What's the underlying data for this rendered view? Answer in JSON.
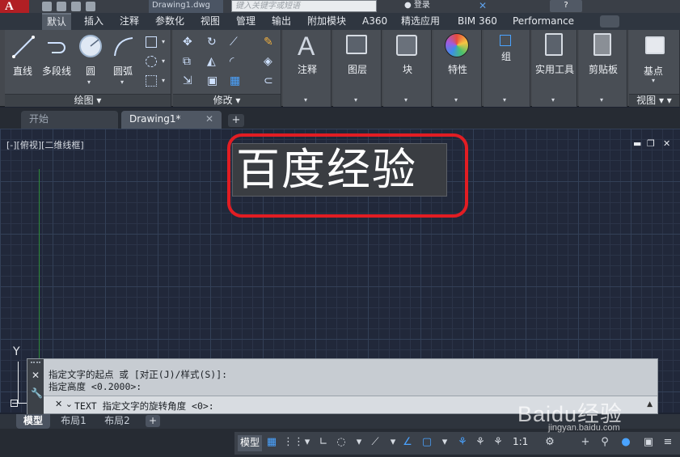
{
  "titlebar": {
    "app_logo": "A",
    "doc_name": "Drawing1.dwg",
    "search_placeholder": "键入关键字或短语",
    "login_label": "登录",
    "help_label": "?"
  },
  "ribbon_tabs": [
    "默认",
    "插入",
    "注释",
    "参数化",
    "视图",
    "管理",
    "输出",
    "附加模块",
    "A360",
    "精选应用",
    "BIM 360",
    "Performance"
  ],
  "draw_panel": {
    "title": "绘图",
    "tools": [
      "直线",
      "多段线",
      "圆",
      "圆弧"
    ]
  },
  "modify_panel": {
    "title": "修改"
  },
  "big_panels": [
    {
      "label": "注释"
    },
    {
      "label": "图层"
    },
    {
      "label": "块"
    },
    {
      "label": "特性"
    },
    {
      "label": "组"
    },
    {
      "label": "实用工具"
    },
    {
      "label": "剪贴板"
    },
    {
      "label": "基点"
    }
  ],
  "view_panel": {
    "title": "视图"
  },
  "file_tabs": {
    "start": "开始",
    "drawing": "Drawing1*"
  },
  "viewport": {
    "label": "[-][俯视][二维线框]",
    "text_object": "百度经验"
  },
  "ucs": {
    "y_label": "Y"
  },
  "command": {
    "history": [
      "指定文字的起点 或 [对正(J)/样式(S)]:",
      "指定高度 <0.2000>:"
    ],
    "prompt": "TEXT 指定文字的旋转角度 <0>:"
  },
  "layout_tabs": [
    "模型",
    "布局1",
    "布局2"
  ],
  "status": {
    "model_label": "模型",
    "scale": "1:1"
  },
  "watermark": {
    "brand": "Baidu经验",
    "url": "jingyan.baidu.com"
  },
  "colors": {
    "highlight_frame": "#e21d23",
    "arrow_outline": "#e21d23",
    "canvas_bg": "#21283a"
  }
}
